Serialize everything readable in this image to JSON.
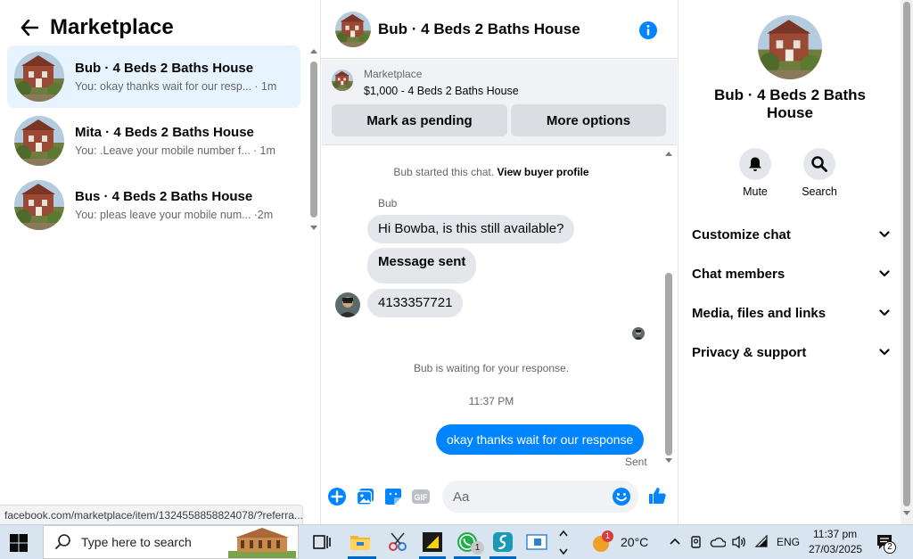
{
  "left": {
    "title": "Marketplace",
    "conversations": [
      {
        "name": "Bub · 4 Beds 2 Baths House",
        "preview": "You: okay thanks wait for our resp...",
        "time": "· 1m"
      },
      {
        "name": "Mita · 4 Beds 2 Baths House",
        "preview": "You: .Leave your mobile number f...",
        "time": "· 1m"
      },
      {
        "name": "Bus · 4 Beds 2 Baths House",
        "preview": "You: pleas leave your mobile num...",
        "time": "·2m"
      }
    ],
    "status_url": "facebook.com/marketplace/item/1324558858824078/?referra..."
  },
  "chat": {
    "title": "Bub · 4 Beds 2 Baths House",
    "listing": {
      "category": "Marketplace",
      "price_title": "$1,000 - 4 Beds 2 Baths House",
      "mark_pending": "Mark as pending",
      "more_options": "More options"
    },
    "started_text": "Bub started this chat.",
    "view_profile": "View buyer profile",
    "sender": "Bub",
    "messages": [
      "Hi Bowba, is this still available?",
      "Message sent",
      "4133357721"
    ],
    "waiting": "Bub is waiting for your response.",
    "timestamp": "11:37 PM",
    "my_message": "okay thanks wait for our response",
    "sent_label": "Sent",
    "input_placeholder": "Aa"
  },
  "details": {
    "title": "Bub · 4 Beds 2 Baths House",
    "mute": "Mute",
    "search": "Search",
    "sections": [
      "Customize chat",
      "Chat members",
      "Media, files and links",
      "Privacy & support"
    ]
  },
  "taskbar": {
    "search_placeholder": "Type here to search",
    "weather": "20°C",
    "weather_badge": "1",
    "language": "ENG",
    "time": "11:37 pm",
    "date": "27/03/2025",
    "notification_count": "2",
    "whatsapp_badge": "1"
  },
  "colors": {
    "accent": "#0084ff",
    "bubble_grey": "#e4e6eb",
    "active_conv": "#e7f3ff",
    "taskbar": "#d9e4f1"
  },
  "icons": [
    "back-arrow-icon",
    "info-icon",
    "bell-icon",
    "search-icon",
    "chevron-down-icon",
    "plus-icon",
    "image-icon",
    "sticker-icon",
    "gif-icon",
    "emoji-icon",
    "like-icon",
    "windows-icon",
    "task-view-icon",
    "file-explorer-icon",
    "whatsapp-icon",
    "notification-icon"
  ]
}
